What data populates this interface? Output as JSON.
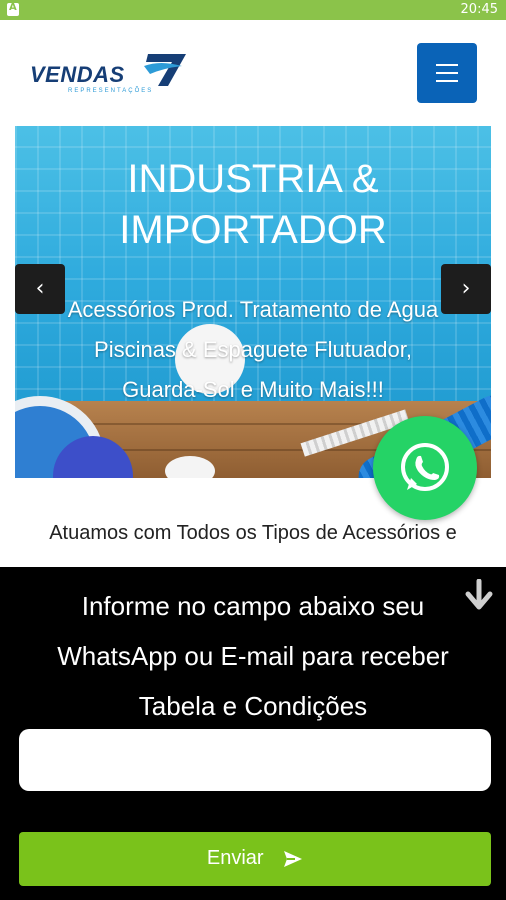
{
  "status_bar": {
    "time": "20:45",
    "notification_icon": "app-notification-icon",
    "color": "#8bc34a"
  },
  "header": {
    "logo": {
      "text": "VENDAS",
      "number": "7",
      "subtitle": "REPRESENTAÇÕES"
    },
    "menu_icon": "hamburger-icon",
    "menu_color": "#0a63b7"
  },
  "hero": {
    "title": "INDUSTRIA & IMPORTADOR",
    "description": "Acessórios Prod. Tratamento de Agua Piscinas & Espaguete Flutuador, Guarda-Sol e Muito Mais!!!",
    "prev_icon": "chevron-left-icon",
    "next_icon": "chevron-right-icon",
    "prev_label": "‹",
    "next_label": "›"
  },
  "whatsapp": {
    "icon": "whatsapp-icon",
    "color": "#25d366"
  },
  "intro": {
    "text": "Atuamos com Todos os Tipos de Acessórios e"
  },
  "lead_form": {
    "message": "Informe no campo abaixo seu WhatsApp ou E-mail para receber Tabela e Condições",
    "input_value": "",
    "input_placeholder": "",
    "submit_label": "Enviar",
    "submit_icon": "send-icon",
    "close_icon": "arrow-down-icon",
    "button_color": "#7ac21b"
  }
}
